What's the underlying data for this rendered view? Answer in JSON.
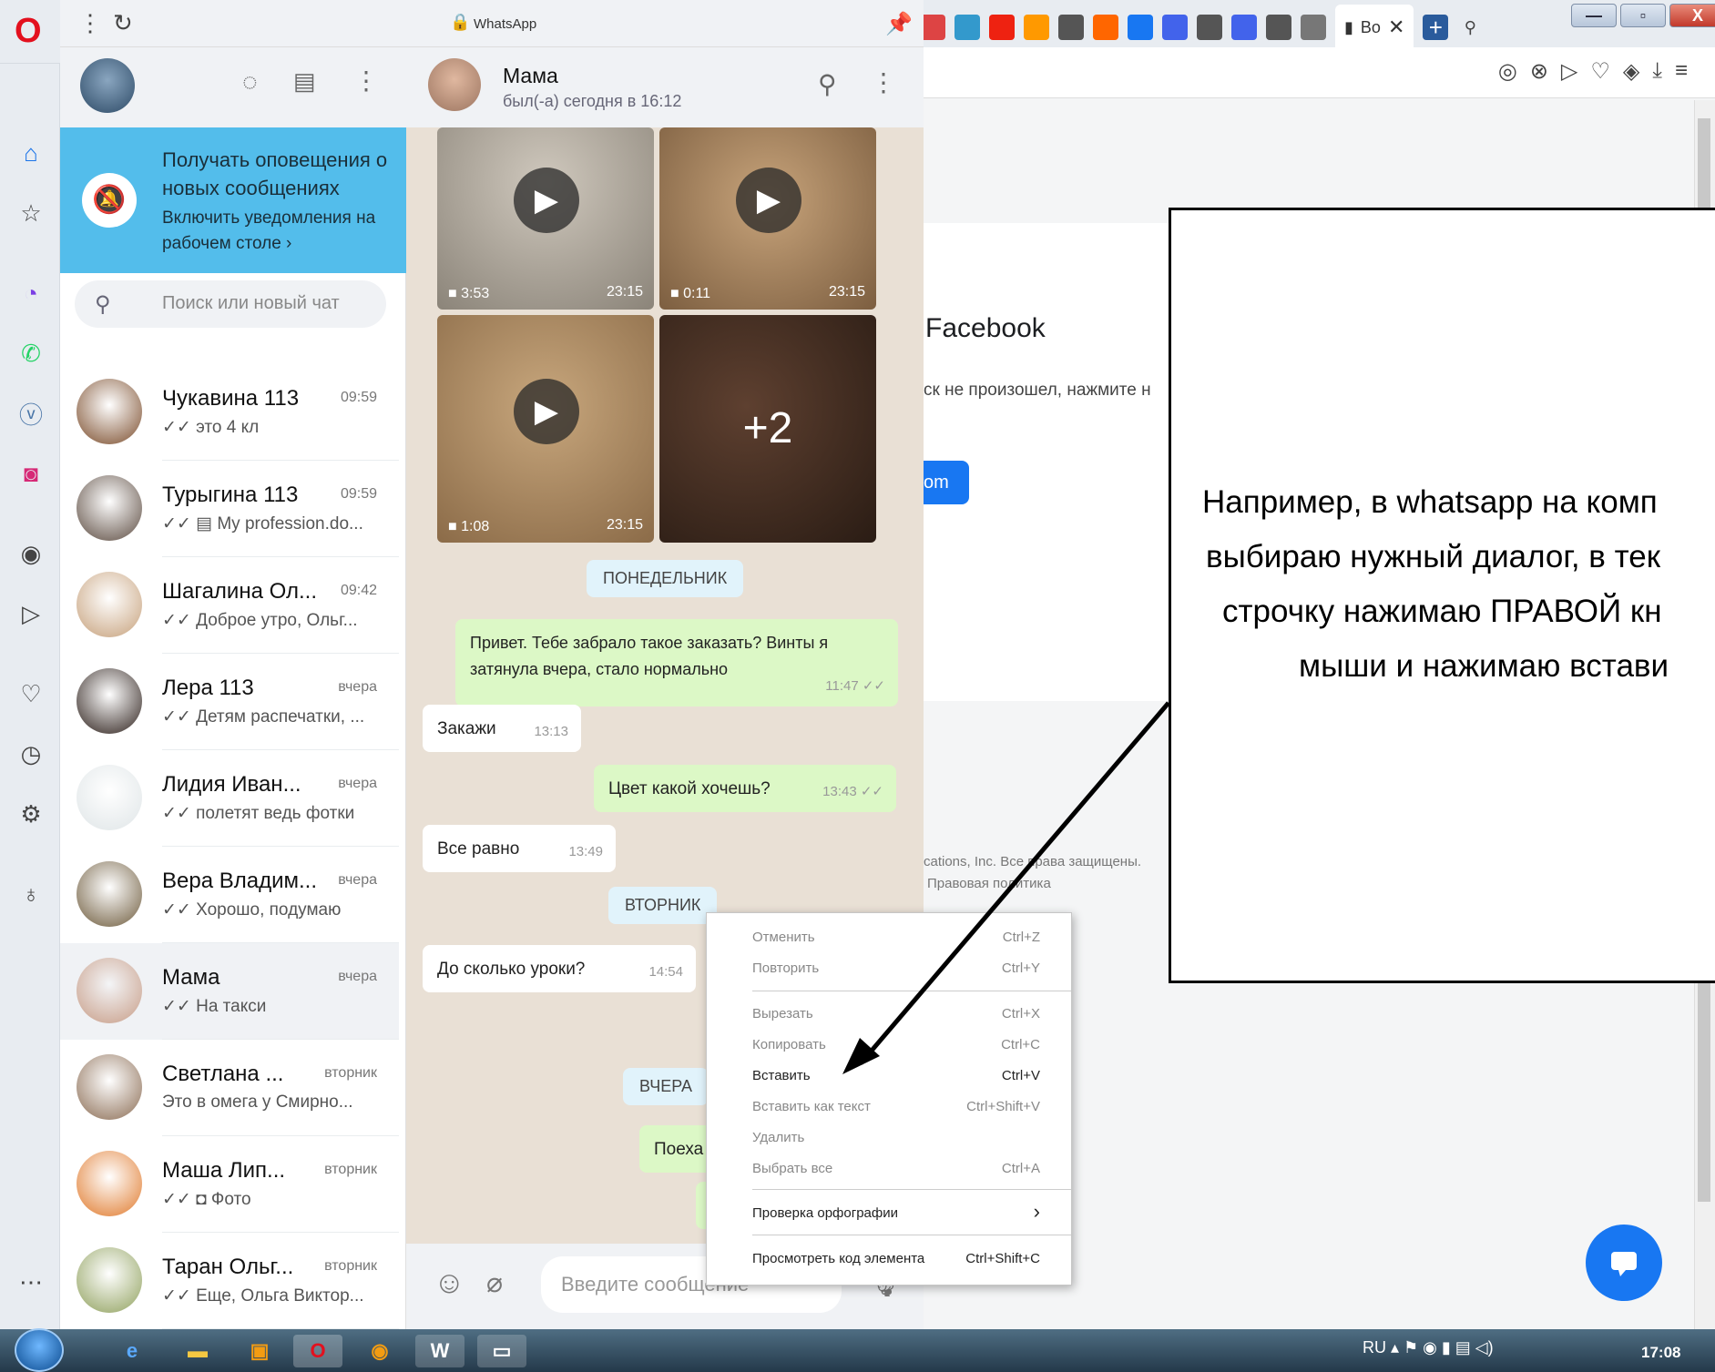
{
  "browser": {
    "logo": "O",
    "address_title": "WhatsApp",
    "active_tab_label": "Bo",
    "window_buttons": [
      "—",
      "▫",
      "X"
    ],
    "tab_icons": [
      {
        "name": "book-icon",
        "color": "#d44"
      },
      {
        "name": "send-icon",
        "color": "#39c"
      },
      {
        "name": "youtube-icon",
        "color": "#e21"
      },
      {
        "name": "ok-icon",
        "color": "#f90"
      },
      {
        "name": "doc-icon",
        "color": "#555"
      },
      {
        "name": "orange-square-icon",
        "color": "#f60"
      },
      {
        "name": "facebook-icon",
        "color": "#1877f2"
      },
      {
        "name": "list-icon",
        "color": "#4263eb"
      },
      {
        "name": "doc-icon",
        "color": "#555"
      },
      {
        "name": "list-icon",
        "color": "#4263eb"
      },
      {
        "name": "doc-icon",
        "color": "#555"
      },
      {
        "name": "grid-icon",
        "color": "#777"
      }
    ]
  },
  "sidebar_icons": [
    "home-icon",
    "star-icon",
    "messenger-icon",
    "whatsapp-icon",
    "vk-icon",
    "instagram-icon",
    "player-icon",
    "send-icon",
    "heart-icon",
    "history-icon",
    "settings-icon",
    "bulb-icon",
    "more-icon"
  ],
  "whatsapp": {
    "notification": {
      "title": "Получать оповещения о новых сообщениях",
      "subtitle": "Включить уведомления на рабочем столе ›"
    },
    "search_placeholder": "Поиск или новый чат",
    "chats": [
      {
        "name": "Чукавина 113",
        "time": "09:59",
        "preview": "✓✓ это 4 кл",
        "color": "#7a4b2a"
      },
      {
        "name": "Турыгина 113",
        "time": "09:59",
        "preview": "✓✓ ▤ My profession.do...",
        "color": "#5b4a3f"
      },
      {
        "name": "Шагалина Ол...",
        "time": "09:42",
        "preview": "✓✓ Доброе утро, Ольг...",
        "color": "#c6a07a"
      },
      {
        "name": "Лера 113",
        "time": "вчера",
        "preview": "✓✓ Детям распечатки, ...",
        "color": "#2c1f1a"
      },
      {
        "name": "Лидия Иван...",
        "time": "вчера",
        "preview": "✓✓ полетят ведь фотки",
        "color": "#dfe5e7"
      },
      {
        "name": "Вера Владим...",
        "time": "вчера",
        "preview": "✓✓ Хорошо, подумаю",
        "color": "#6d5a3b"
      },
      {
        "name": "Мама",
        "time": "вчера",
        "preview": "✓✓ На такси",
        "color": "#c79c86"
      },
      {
        "name": "Светлана ...",
        "time": "вторник",
        "preview": "Это в омега у Смирно...",
        "color": "#8a6b52"
      },
      {
        "name": "Маша Лип...",
        "time": "вторник",
        "preview": "✓✓ ◘ Фото",
        "color": "#e0792b"
      },
      {
        "name": "Таран Ольг...",
        "time": "вторник",
        "preview": "✓✓ Еще, Ольга Виктор...",
        "color": "#8fa05c"
      }
    ],
    "contact": {
      "name": "Мама",
      "status": "был(-а) сегодня в 16:12"
    },
    "videos": [
      {
        "duration": "3:53",
        "time": "23:15"
      },
      {
        "duration": "0:11",
        "time": "23:15"
      },
      {
        "duration": "1:08",
        "time": "23:15"
      },
      {
        "more": "+2"
      }
    ],
    "days": [
      "ПОНЕДЕЛЬНИК",
      "ВТОРНИК",
      "ВЧЕРА"
    ],
    "messages": [
      {
        "text": "Привет. Тебе забрало такое заказать? Винты я затянула вчера, стало нормально",
        "time": "11:47 ✓✓"
      },
      {
        "text": "Закажи",
        "time": "13:13"
      },
      {
        "text": "Цвет какой хочешь?",
        "time": "13:43 ✓✓"
      },
      {
        "text": "Все равно",
        "time": "13:49"
      },
      {
        "text": "До сколько уроки?",
        "time": "14:54"
      },
      {
        "text": "Поеха",
        "time": ""
      }
    ],
    "input_placeholder": "Введите сообщение"
  },
  "context_menu": [
    {
      "label": "Отменить",
      "shortcut": "Ctrl+Z"
    },
    {
      "label": "Повторить",
      "shortcut": "Ctrl+Y"
    },
    {
      "label": "Вырезать",
      "shortcut": "Ctrl+X"
    },
    {
      "label": "Копировать",
      "shortcut": "Ctrl+C"
    },
    {
      "label": "Вставить",
      "shortcut": "Ctrl+V"
    },
    {
      "label": "Вставить как текст",
      "shortcut": "Ctrl+Shift+V"
    },
    {
      "label": "Удалить",
      "shortcut": ""
    },
    {
      "label": "Выбрать все",
      "shortcut": "Ctrl+A"
    },
    {
      "label": "Проверка орфографии",
      "shortcut": "›"
    },
    {
      "label": "Просмотреть код элемента",
      "shortcut": "Ctrl+Shift+C"
    }
  ],
  "facebook_page": {
    "heading": "Facebook",
    "text": "ск не произошел, нажмите н",
    "button": "om",
    "footer1": "cations, Inc. Все права защищены.",
    "footer2": "Правовая политика"
  },
  "callout": {
    "lines": [
      "Например, в whatsapp на комп",
      "выбираю нужный диалог, в тек",
      "строчку нажимаю ПРАВОЙ кн",
      "мыши и нажимаю встави"
    ]
  },
  "taskbar": {
    "lang": "RU",
    "time": "17:08"
  }
}
